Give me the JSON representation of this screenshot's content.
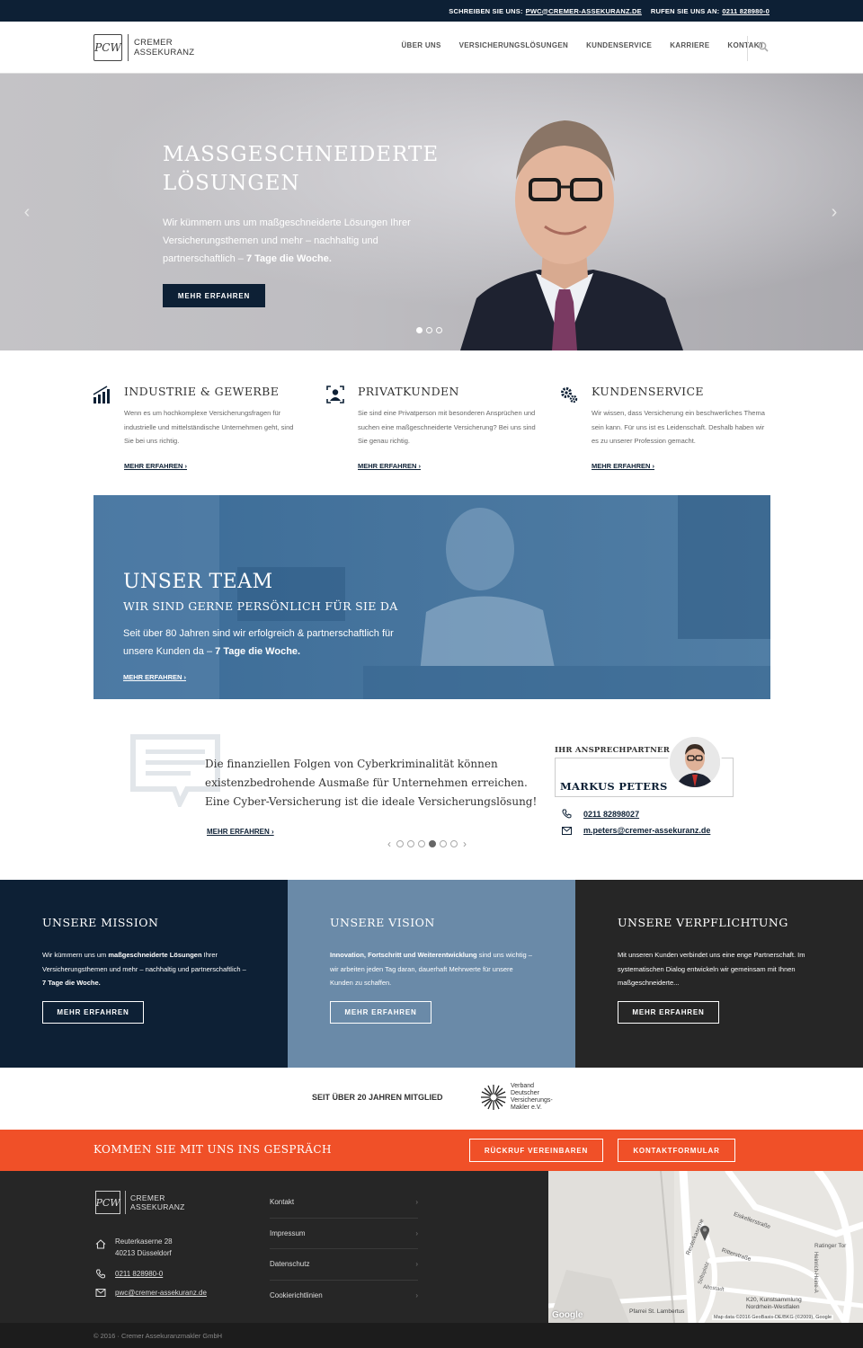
{
  "topbar": {
    "write_label": "SCHREIBEN SIE UNS:",
    "email": "PWC@CREMER-ASSEKURANZ.DE",
    "call_label": "RUFEN SIE UNS AN:",
    "phone": "0211 828980-0"
  },
  "header": {
    "logo_mark": "PCW",
    "logo_line1": "CREMER",
    "logo_line2": "ASSEKURANZ",
    "nav": [
      "ÜBER UNS",
      "VERSICHERUNGSLÖSUNGEN",
      "KUNDENSERVICE",
      "KARRIERE",
      "KONTAKT"
    ]
  },
  "hero": {
    "title_line1": "MASSGESCHNEIDERTE",
    "title_line2": "LÖSUNGEN",
    "text": "Wir kümmern uns um maßgeschneiderte Lösungen Ihrer Versicherungsthemen und mehr – nachhaltig und partnerschaftlich – ",
    "text_bold": "7 Tage die Woche.",
    "button": "MEHR ERFAHREN",
    "prev_arrow": "‹",
    "next_arrow": "›"
  },
  "features": [
    {
      "title": "INDUSTRIE & GEWERBE",
      "text": "Wenn es um hochkomplexe Versicherungsfragen für industrielle und mittelständische Unternehmen geht, sind Sie bei uns richtig.",
      "link": "MEHR ERFAHREN ›",
      "icon": "bar-chart-icon"
    },
    {
      "title": "PRIVATKUNDEN",
      "text": "Sie sind eine Privatperson mit besonderen Ansprüchen und suchen eine maßgeschneiderte Versicherung? Bei uns sind Sie genau richtig.",
      "link": "MEHR ERFAHREN ›",
      "icon": "person-icon"
    },
    {
      "title": "KUNDENSERVICE",
      "text": "Wir wissen, dass Versicherung ein beschwerliches Thema sein kann. Für uns ist es Leidenschaft. Deshalb haben wir es zu unserer Profession gemacht.",
      "link": "MEHR ERFAHREN ›",
      "icon": "gears-icon"
    }
  ],
  "team": {
    "title": "UNSER TEAM",
    "subtitle": "WIR SIND GERNE PERSÖNLICH FÜR SIE DA",
    "text": "Seit über 80 Jahren sind wir erfolgreich & partnerschaftlich für unsere Kunden da – ",
    "text_bold": "7 Tage die Woche.",
    "link": "MEHR ERFAHREN ›"
  },
  "quote": {
    "text": "Die finanziellen Folgen von Cyberkriminalität können existenzbedrohende Ausmaße für Unternehmen erreichen. Eine Cyber-Versicherung ist die ideale Versicherungslösung!",
    "link": "MEHR ERFAHREN ›",
    "prev": "‹",
    "next": "›"
  },
  "contact": {
    "heading": "IHR ANSPRECHPARTNER",
    "name": "MARKUS PETERS",
    "phone": "0211 82898027",
    "email": "m.peters@cremer-assekuranz.de"
  },
  "columns": [
    {
      "title": "UNSERE MISSION",
      "p1": "Wir kümmern uns um ",
      "b1": "maßgeschneiderte Lösungen",
      "p2": " Ihrer Versicherungsthemen und mehr – nachhaltig und partnerschaftlich – ",
      "b2": "7 Tage die Woche.",
      "button": "MEHR ERFAHREN",
      "bg": "#0d2035"
    },
    {
      "title": "UNSERE VISION",
      "p1": "",
      "b1": "Innovation, Fortschritt und Weiterentwicklung",
      "p2": " sind uns wichtig – wir arbeiten jeden Tag daran, dauerhaft Mehrwerte für unsere Kunden zu schaffen.",
      "b2": "",
      "button": "MEHR ERFAHREN",
      "bg": "#6a8aa8"
    },
    {
      "title": "UNSERE VERPFLICHTUNG",
      "p1": "Mit unseren Kunden verbindet uns eine enge Partnerschaft. Im systematischen Dialog entwickeln wir gemeinsam mit Ihnen maßgeschneiderte...",
      "b1": "",
      "p2": "",
      "b2": "",
      "button": "MEHR ERFAHREN",
      "bg": "#262626"
    }
  ],
  "member": {
    "label": "SEIT ÜBER 20 JAHREN MITGLIED",
    "vdvm_line1": "Verband",
    "vdvm_line2": "Deutscher",
    "vdvm_line3": "Versicherungs-",
    "vdvm_line4": "Makler e.V."
  },
  "cta": {
    "text": "KOMMEN SIE MIT UNS INS GESPRÄCH",
    "callback": "RÜCKRUF VEREINBAREN",
    "form": "KONTAKTFORMULAR",
    "bg": "#f05028"
  },
  "footer": {
    "logo_mark": "PCW",
    "logo_line1": "CREMER",
    "logo_line2": "ASSEKURANZ",
    "street": "Reuterkaserne 28",
    "city": "40213 Düsseldorf",
    "phone": "0211 828980-0",
    "email": "pwc@cremer-assekuranz.de",
    "links": [
      "Kontakt",
      "Impressum",
      "Datenschutz",
      "Cookierichtlinien"
    ],
    "copyright": "© 2016 · Cremer Assekuranzmakler GmbH"
  },
  "map": {
    "labels": [
      "Eiskellerstraße",
      "Ritterstraße",
      "Reuterkaserne",
      "Altestadt",
      "Ratinger Tor",
      "Heinrich-Heine-A",
      "K20, Kunstsammlung Nordrhein-Westfalen",
      "Pfarrei St. Lambertus",
      "Stiftsplatz"
    ],
    "logo": "Google",
    "attribution": "Map data ©2016 GeoBasis-DE/BKG (©2009), Google"
  }
}
